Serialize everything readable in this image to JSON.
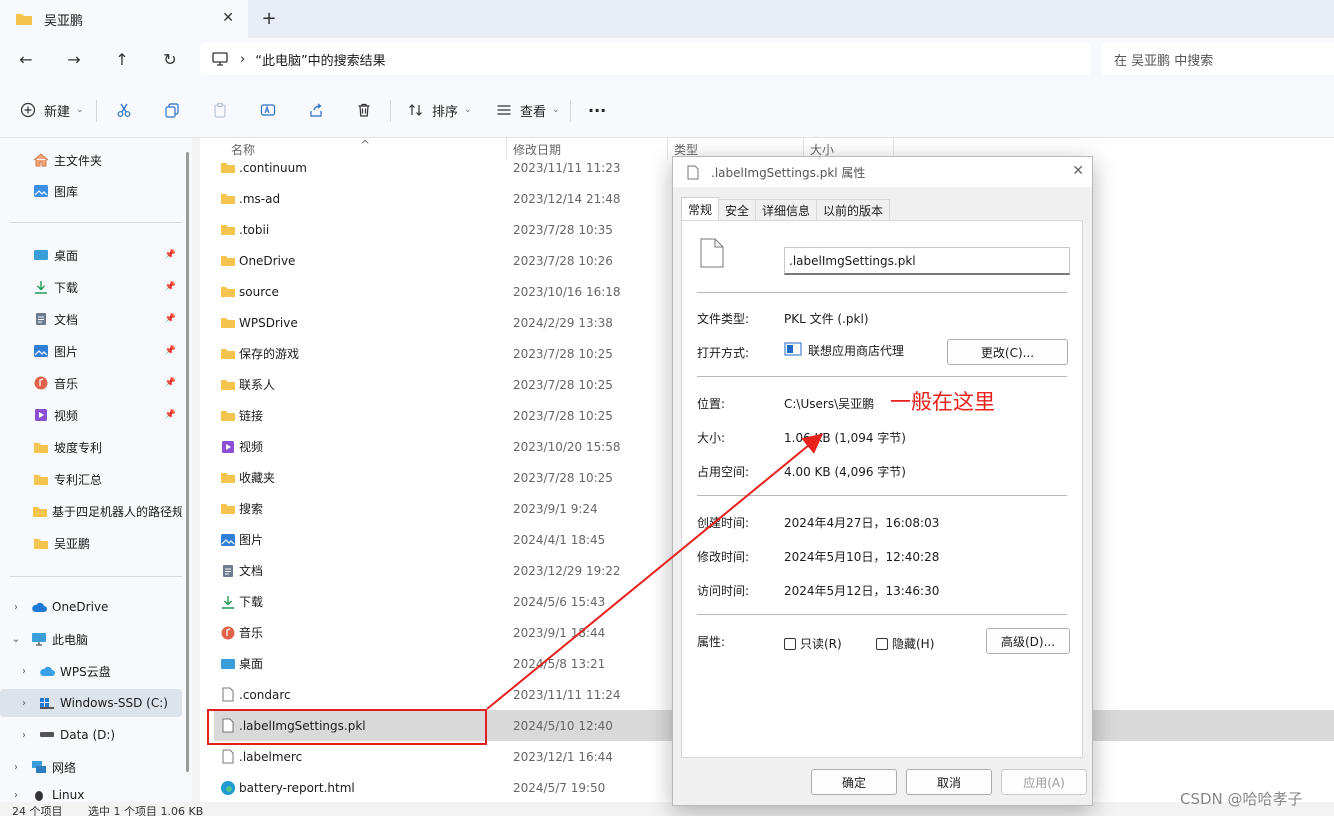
{
  "tab": {
    "title": "吴亚鹏",
    "close": "✕",
    "new": "+"
  },
  "address": {
    "path": "“此电脑”中的搜索结果",
    "sep": "›",
    "search_placeholder": "在 吴亚鹏 中搜索"
  },
  "cmdbar": {
    "new": "新建",
    "sort": "排序",
    "view": "查看",
    "more": "···"
  },
  "sidebar": {
    "home": "主文件夹",
    "gallery": "图库",
    "quick": [
      "桌面",
      "下载",
      "文档",
      "图片",
      "音乐",
      "视频",
      "坡度专利",
      "专利汇总",
      "基于四足机器人的路径规",
      "吴亚鹏"
    ],
    "tree": [
      "OneDrive",
      "此电脑",
      "WPS云盘",
      "Windows-SSD (C:)",
      "Data (D:)",
      "网络",
      "Linux"
    ]
  },
  "columns": {
    "name": "名称",
    "date": "修改日期",
    "type": "类型",
    "size": "大小"
  },
  "files": [
    {
      "name": ".continuum",
      "date": "2023/11/11 11:23"
    },
    {
      "name": ".ms-ad",
      "date": "2023/12/14 21:48"
    },
    {
      "name": ".tobii",
      "date": "2023/7/28 10:35"
    },
    {
      "name": "OneDrive",
      "date": "2023/7/28 10:26"
    },
    {
      "name": "source",
      "date": "2023/10/16 16:18"
    },
    {
      "name": "WPSDrive",
      "date": "2024/2/29 13:38"
    },
    {
      "name": "保存的游戏",
      "date": "2023/7/28 10:25"
    },
    {
      "name": "联系人",
      "date": "2023/7/28 10:25"
    },
    {
      "name": "链接",
      "date": "2023/7/28 10:25"
    },
    {
      "name": "视频",
      "date": "2023/10/20 15:58"
    },
    {
      "name": "收藏夹",
      "date": "2023/7/28 10:25"
    },
    {
      "name": "搜索",
      "date": "2023/9/1 9:24"
    },
    {
      "name": "图片",
      "date": "2024/4/1 18:45"
    },
    {
      "name": "文档",
      "date": "2023/12/29 19:22"
    },
    {
      "name": "下载",
      "date": "2024/5/6 15:43"
    },
    {
      "name": "音乐",
      "date": "2023/9/1 18:44"
    },
    {
      "name": "桌面",
      "date": "2024/5/8 13:21"
    },
    {
      "name": ".condarc",
      "date": "2023/11/11 11:24"
    },
    {
      "name": ".labelImgSettings.pkl",
      "date": "2024/5/10 12:40"
    },
    {
      "name": ".labelmerc",
      "date": "2023/12/1 16:44"
    },
    {
      "name": "battery-report.html",
      "date": "2024/5/7 19:50"
    }
  ],
  "status": {
    "count": "24 个项目",
    "selected": "选中 1 个项目 1.06 KB"
  },
  "dialog": {
    "title": ".labelImgSettings.pkl 属性",
    "tabs": [
      "常规",
      "安全",
      "详细信息",
      "以前的版本"
    ],
    "filename": ".labelImgSettings.pkl",
    "type_label": "文件类型:",
    "type_value": "PKL 文件 (.pkl)",
    "open_label": "打开方式:",
    "open_value": "联想应用商店代理",
    "change_btn": "更改(C)...",
    "loc_label": "位置:",
    "loc_value": "C:\\Users\\吴亚鹏",
    "size_label": "大小:",
    "size_value": "1.06 KB (1,094 字节)",
    "disk_label": "占用空间:",
    "disk_value": "4.00 KB (4,096 字节)",
    "created_label": "创建时间:",
    "created_value": "2024年4月27日，16:08:03",
    "modified_label": "修改时间:",
    "modified_value": "2024年5月10日，12:40:28",
    "accessed_label": "访问时间:",
    "accessed_value": "2024年5月12日，13:46:30",
    "attr_label": "属性:",
    "readonly": "只读(R)",
    "hidden": "隐藏(H)",
    "advanced_btn": "高级(D)...",
    "ok": "确定",
    "cancel": "取消",
    "apply": "应用(A)"
  },
  "annotation": "一般在这里",
  "watermark": "CSDN @哈哈孝子",
  "colors": {
    "annotation": "#e8211c",
    "folder": "#f4c44e"
  }
}
